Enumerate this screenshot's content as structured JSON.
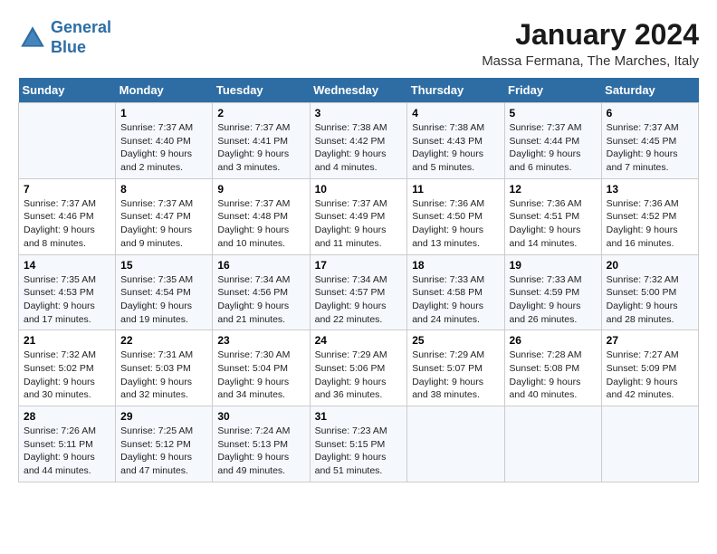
{
  "header": {
    "logo_line1": "General",
    "logo_line2": "Blue",
    "main_title": "January 2024",
    "subtitle": "Massa Fermana, The Marches, Italy"
  },
  "days_of_week": [
    "Sunday",
    "Monday",
    "Tuesday",
    "Wednesday",
    "Thursday",
    "Friday",
    "Saturday"
  ],
  "weeks": [
    [
      {
        "day": "",
        "info": ""
      },
      {
        "day": "1",
        "info": "Sunrise: 7:37 AM\nSunset: 4:40 PM\nDaylight: 9 hours\nand 2 minutes."
      },
      {
        "day": "2",
        "info": "Sunrise: 7:37 AM\nSunset: 4:41 PM\nDaylight: 9 hours\nand 3 minutes."
      },
      {
        "day": "3",
        "info": "Sunrise: 7:38 AM\nSunset: 4:42 PM\nDaylight: 9 hours\nand 4 minutes."
      },
      {
        "day": "4",
        "info": "Sunrise: 7:38 AM\nSunset: 4:43 PM\nDaylight: 9 hours\nand 5 minutes."
      },
      {
        "day": "5",
        "info": "Sunrise: 7:37 AM\nSunset: 4:44 PM\nDaylight: 9 hours\nand 6 minutes."
      },
      {
        "day": "6",
        "info": "Sunrise: 7:37 AM\nSunset: 4:45 PM\nDaylight: 9 hours\nand 7 minutes."
      }
    ],
    [
      {
        "day": "7",
        "info": "Sunrise: 7:37 AM\nSunset: 4:46 PM\nDaylight: 9 hours\nand 8 minutes."
      },
      {
        "day": "8",
        "info": "Sunrise: 7:37 AM\nSunset: 4:47 PM\nDaylight: 9 hours\nand 9 minutes."
      },
      {
        "day": "9",
        "info": "Sunrise: 7:37 AM\nSunset: 4:48 PM\nDaylight: 9 hours\nand 10 minutes."
      },
      {
        "day": "10",
        "info": "Sunrise: 7:37 AM\nSunset: 4:49 PM\nDaylight: 9 hours\nand 11 minutes."
      },
      {
        "day": "11",
        "info": "Sunrise: 7:36 AM\nSunset: 4:50 PM\nDaylight: 9 hours\nand 13 minutes."
      },
      {
        "day": "12",
        "info": "Sunrise: 7:36 AM\nSunset: 4:51 PM\nDaylight: 9 hours\nand 14 minutes."
      },
      {
        "day": "13",
        "info": "Sunrise: 7:36 AM\nSunset: 4:52 PM\nDaylight: 9 hours\nand 16 minutes."
      }
    ],
    [
      {
        "day": "14",
        "info": "Sunrise: 7:35 AM\nSunset: 4:53 PM\nDaylight: 9 hours\nand 17 minutes."
      },
      {
        "day": "15",
        "info": "Sunrise: 7:35 AM\nSunset: 4:54 PM\nDaylight: 9 hours\nand 19 minutes."
      },
      {
        "day": "16",
        "info": "Sunrise: 7:34 AM\nSunset: 4:56 PM\nDaylight: 9 hours\nand 21 minutes."
      },
      {
        "day": "17",
        "info": "Sunrise: 7:34 AM\nSunset: 4:57 PM\nDaylight: 9 hours\nand 22 minutes."
      },
      {
        "day": "18",
        "info": "Sunrise: 7:33 AM\nSunset: 4:58 PM\nDaylight: 9 hours\nand 24 minutes."
      },
      {
        "day": "19",
        "info": "Sunrise: 7:33 AM\nSunset: 4:59 PM\nDaylight: 9 hours\nand 26 minutes."
      },
      {
        "day": "20",
        "info": "Sunrise: 7:32 AM\nSunset: 5:00 PM\nDaylight: 9 hours\nand 28 minutes."
      }
    ],
    [
      {
        "day": "21",
        "info": "Sunrise: 7:32 AM\nSunset: 5:02 PM\nDaylight: 9 hours\nand 30 minutes."
      },
      {
        "day": "22",
        "info": "Sunrise: 7:31 AM\nSunset: 5:03 PM\nDaylight: 9 hours\nand 32 minutes."
      },
      {
        "day": "23",
        "info": "Sunrise: 7:30 AM\nSunset: 5:04 PM\nDaylight: 9 hours\nand 34 minutes."
      },
      {
        "day": "24",
        "info": "Sunrise: 7:29 AM\nSunset: 5:06 PM\nDaylight: 9 hours\nand 36 minutes."
      },
      {
        "day": "25",
        "info": "Sunrise: 7:29 AM\nSunset: 5:07 PM\nDaylight: 9 hours\nand 38 minutes."
      },
      {
        "day": "26",
        "info": "Sunrise: 7:28 AM\nSunset: 5:08 PM\nDaylight: 9 hours\nand 40 minutes."
      },
      {
        "day": "27",
        "info": "Sunrise: 7:27 AM\nSunset: 5:09 PM\nDaylight: 9 hours\nand 42 minutes."
      }
    ],
    [
      {
        "day": "28",
        "info": "Sunrise: 7:26 AM\nSunset: 5:11 PM\nDaylight: 9 hours\nand 44 minutes."
      },
      {
        "day": "29",
        "info": "Sunrise: 7:25 AM\nSunset: 5:12 PM\nDaylight: 9 hours\nand 47 minutes."
      },
      {
        "day": "30",
        "info": "Sunrise: 7:24 AM\nSunset: 5:13 PM\nDaylight: 9 hours\nand 49 minutes."
      },
      {
        "day": "31",
        "info": "Sunrise: 7:23 AM\nSunset: 5:15 PM\nDaylight: 9 hours\nand 51 minutes."
      },
      {
        "day": "",
        "info": ""
      },
      {
        "day": "",
        "info": ""
      },
      {
        "day": "",
        "info": ""
      }
    ]
  ]
}
